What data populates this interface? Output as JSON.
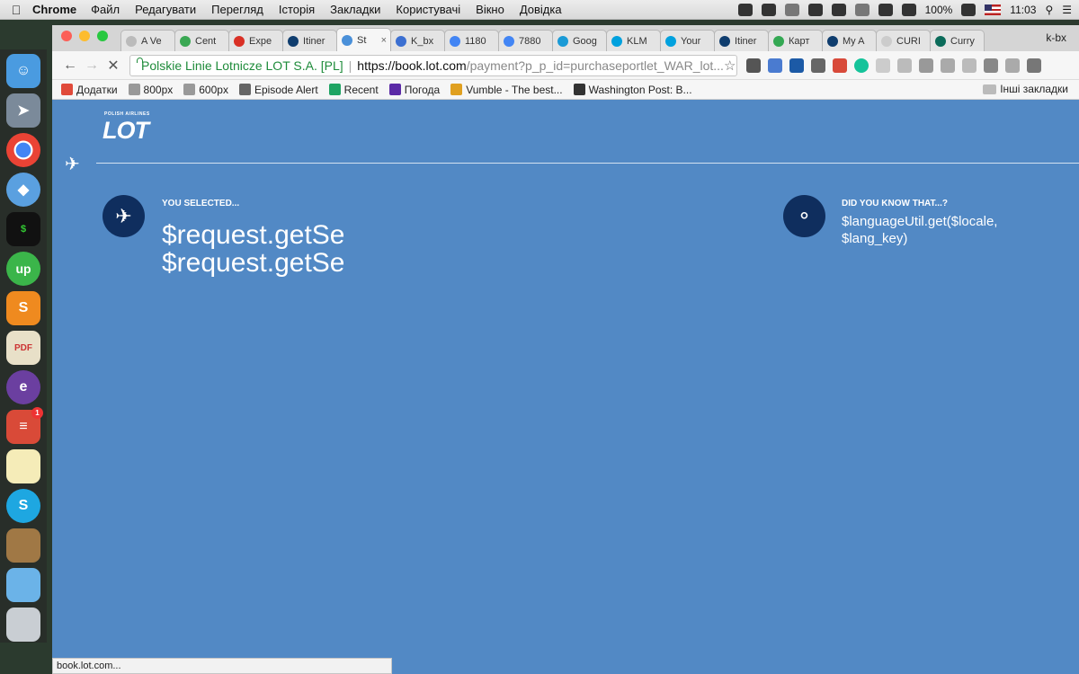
{
  "menubar": {
    "app_name": "Chrome",
    "items": [
      "Файл",
      "Редагувати",
      "Перегляд",
      "Історія",
      "Закладки",
      "Користувачі",
      "Вікно",
      "Довідка"
    ],
    "battery": "100%",
    "time": "11:03"
  },
  "tabs": [
    {
      "label": "A Ve",
      "color": "#bbbbbb"
    },
    {
      "label": "Cent",
      "color": "#3aa853"
    },
    {
      "label": "Expe",
      "color": "#d93025"
    },
    {
      "label": "Itiner",
      "color": "#0f3d6e"
    },
    {
      "label": "St",
      "color": "#4a90d9",
      "active": true
    },
    {
      "label": "K_bx",
      "color": "#3b6fd1"
    },
    {
      "label": "1180",
      "color": "#4285f4"
    },
    {
      "label": "7880",
      "color": "#4285f4"
    },
    {
      "label": "Goog",
      "color": "#1a9ad6"
    },
    {
      "label": "KLM",
      "color": "#00a1de"
    },
    {
      "label": "Your",
      "color": "#00a1de"
    },
    {
      "label": "Itiner",
      "color": "#0f3d6e"
    },
    {
      "label": "Карт",
      "color": "#34a853"
    },
    {
      "label": "My A",
      "color": "#0f3d6e"
    },
    {
      "label": "CURI",
      "color": "#cccccc"
    },
    {
      "label": "Curry",
      "color": "#0b6b5a"
    }
  ],
  "profile_name": "k-bx",
  "address_bar": {
    "site_name": "Polskie Linie Lotnicze LOT S.A. [PL]",
    "url_host": "https://book.lot.com",
    "url_rest": "/payment?p_p_id=purchaseportlet_WAR_lot..."
  },
  "bookmarks": [
    {
      "label": "Додатки",
      "color": "#e04a3a"
    },
    {
      "label": "800px",
      "color": "#999999"
    },
    {
      "label": "600px",
      "color": "#999999"
    },
    {
      "label": "Episode Alert",
      "color": "#666666"
    },
    {
      "label": "Recent",
      "color": "#1fa463"
    },
    {
      "label": "Погода",
      "color": "#5b2aa6"
    },
    {
      "label": "Vumble - The best...",
      "color": "#e0a020"
    },
    {
      "label": "Washington Post: B...",
      "color": "#333333"
    }
  ],
  "other_bookmarks": "Інші закладки",
  "page": {
    "logo_small": "POLISH AIRLINES",
    "logo_big": "LOT",
    "you_selected_label": "YOU SELECTED...",
    "you_selected_line1": "$request.getSes",
    "you_selected_line2": "$request.getSes",
    "did_you_know_label": "DID YOU KNOW THAT...?",
    "did_you_know_text": "$languageUtil.get($locale, $lang_key)"
  },
  "status_bar": "book.lot.com...",
  "dock_badge": "1",
  "colors": {
    "page_bg": "#5289c5",
    "icon_circle": "#0f2e5e",
    "secure_green": "#1e8b3a"
  }
}
